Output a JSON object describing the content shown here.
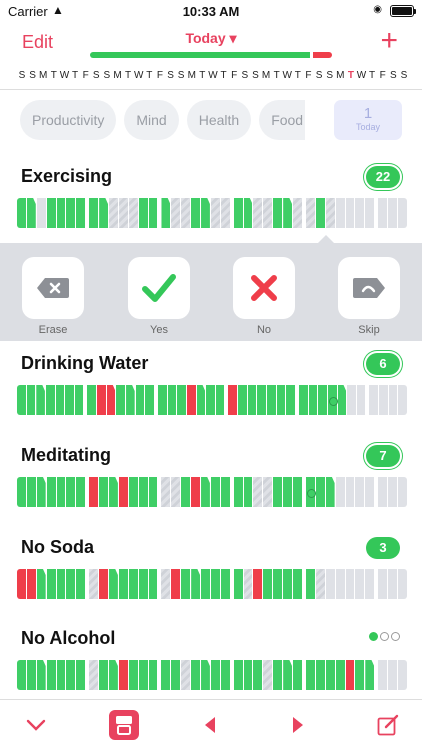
{
  "status_bar": {
    "carrier": "Carrier",
    "time": "10:33 AM"
  },
  "nav": {
    "edit_label": "Edit",
    "title": "Today",
    "add_icon": "plus-icon"
  },
  "progress": {
    "done_fraction": 0.92,
    "missed_fraction": 0.08
  },
  "weekdays": [
    "S",
    "S",
    "M",
    "T",
    "W",
    "T",
    "F",
    "S",
    "S",
    "M",
    "T",
    "W",
    "T",
    "F",
    "S",
    "S",
    "M",
    "T",
    "W",
    "T",
    "F",
    "S",
    "S",
    "M",
    "T",
    "W",
    "T",
    "F",
    "S",
    "S",
    "M",
    "T",
    "W",
    "T",
    "F",
    "S",
    "S"
  ],
  "current_day_index": 31,
  "categories": [
    "Productivity",
    "Mind",
    "Health",
    "Food"
  ],
  "day_selector": {
    "number": "1",
    "label": "Today"
  },
  "habits": [
    {
      "name": "Exercising",
      "count": "22",
      "statuses": "GgoGGGGGgsssGGgssGgssGgssGgssGsEEEEEEE"
    },
    {
      "name": "Drinking Water",
      "count": "6",
      "statuses": "GGgGGGGGRrGgGGGGGRgGGRGGGGGGGGGOgEEEEEE"
    },
    {
      "name": "Meditating",
      "count": "7",
      "statuses": "GGgGGGGRGgRGGGssGRgGGGGssGGGOGgEEEEEEE"
    },
    {
      "name": "No Soda",
      "count": "3",
      "statuses": "RRgGGGGsRgGGGGsRGgGGGGsRGGGGGsEEEEEEEE"
    }
  ],
  "quick_actions": [
    {
      "label": "Erase",
      "icon": "erase-icon"
    },
    {
      "label": "Yes",
      "icon": "check-icon"
    },
    {
      "label": "No",
      "icon": "cross-icon"
    },
    {
      "label": "Skip",
      "icon": "skip-icon"
    }
  ],
  "last_habit": {
    "name": "No Alcohol",
    "statuses": "GGgGGGGsGgRGGGGGsGgGGGGGsGgGGGGGRGgEEE",
    "progress_dots": 1,
    "progress_total": 3
  },
  "toolbar": [
    "collapse-icon",
    "archive-icon",
    "previous-icon",
    "next-icon",
    "compose-icon"
  ]
}
